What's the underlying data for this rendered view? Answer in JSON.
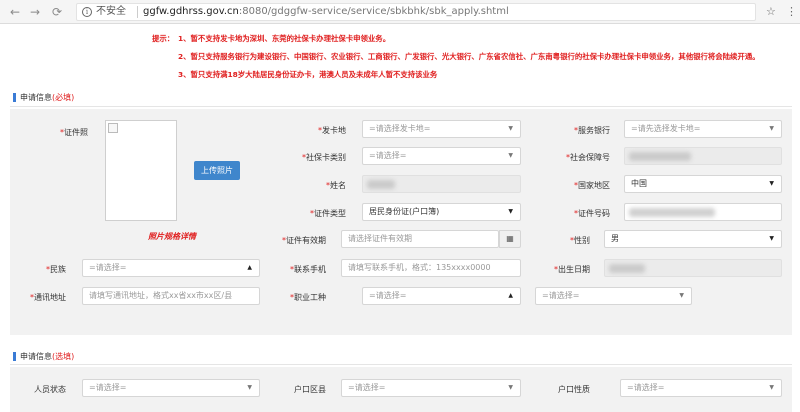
{
  "browser": {
    "back": "←",
    "forward": "→",
    "reload": "⟳",
    "insecure_label": "不安全",
    "url_host": "ggfw.gdhrss.gov.cn",
    "url_path": ":8080/gdggfw-service/service/sbkbhk/sbk_apply.shtml",
    "star": "☆",
    "menu": "⋮"
  },
  "notice": {
    "lead": "提示：",
    "lines": [
      "1、暂不支持发卡地为深圳、东莞的社保卡办理社保卡申领业务。",
      "2、暂只支持服务银行为建设银行、中国银行、农业银行、工商银行、广发银行、光大银行、广东省农信社、广东南粤银行的社保卡办理社保卡申领业务，其他银行将会陆续开通。",
      "3、暂只支持满18岁大陆居民身份证办卡，港澳人员及未成年人暂不支持该业务"
    ]
  },
  "section_required": {
    "title": "申请信息",
    "tag": "(必填)"
  },
  "section_optional": {
    "title": "申请信息",
    "tag": "(选填)"
  },
  "req_mark": "*",
  "photo": {
    "label": "证件照",
    "upload_button": "上传照片",
    "spec_link": "照片规格详情"
  },
  "fields": {
    "issue_place": {
      "label": "发卡地",
      "placeholder": "=请选择发卡地="
    },
    "service_bank": {
      "label": "服务银行",
      "placeholder": "=请先选择发卡地="
    },
    "card_type": {
      "label": "社保卡类别",
      "placeholder": "=请选择="
    },
    "ss_number": {
      "label": "社会保障号"
    },
    "name": {
      "label": "姓名"
    },
    "country": {
      "label": "国家地区",
      "value": "中国"
    },
    "id_type": {
      "label": "证件类型",
      "value": "居民身份证(户口簿)"
    },
    "id_number": {
      "label": "证件号码"
    },
    "id_validity": {
      "label": "证件有效期",
      "placeholder": "请选择证件有效期",
      "calendar_icon": "▦"
    },
    "gender": {
      "label": "性别",
      "value": "男"
    },
    "ethnicity": {
      "label": "民族",
      "placeholder": "=请选择="
    },
    "phone": {
      "label": "联系手机",
      "placeholder": "请填写联系手机，格式：135xxxx0000"
    },
    "birth_date": {
      "label": "出生日期"
    },
    "address": {
      "label": "通讯地址",
      "placeholder": "请填写通讯地址，格式xx省xx市xx区/县"
    },
    "occupation": {
      "label": "职业工种",
      "placeholder": "=请选择=",
      "placeholder2": "=请选择="
    },
    "person_status": {
      "label": "人员状态",
      "placeholder": "=请选择="
    },
    "hukou_district": {
      "label": "户口区县",
      "placeholder": "=请选择="
    },
    "hukou_nature": {
      "label": "户口性质",
      "placeholder": "=请选择="
    }
  }
}
